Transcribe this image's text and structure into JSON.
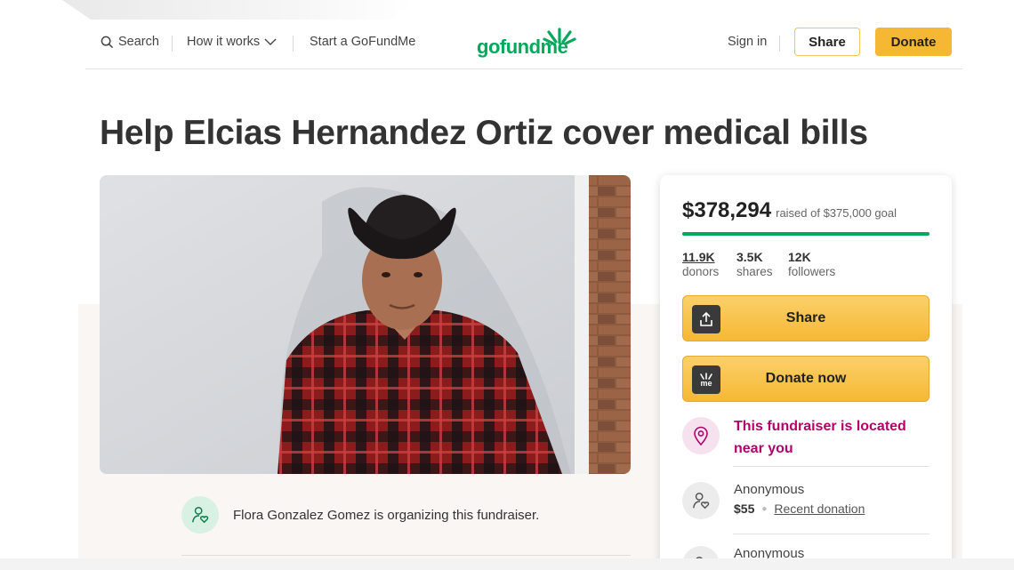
{
  "nav": {
    "search_label": "Search",
    "how_label": "How it works",
    "start_label": "Start a GoFundMe",
    "logo_text": "gofundme",
    "signin_label": "Sign in",
    "share_label": "Share",
    "donate_label": "Donate"
  },
  "campaign": {
    "title": "Help Elcias Hernandez Ortiz cover medical bills",
    "organizer_text": "Flora Gonzalez Gomez is organizing this fundraiser."
  },
  "card": {
    "raised_amount": "$378,294",
    "raised_goal": "raised of $375,000 goal",
    "progress_fraction": 1.0,
    "donors_num": "11.9K",
    "donors_label": "donors",
    "shares_num": "3.5K",
    "shares_label": "shares",
    "followers_num": "12K",
    "followers_label": "followers",
    "share_button": "Share",
    "donate_button": "Donate now",
    "donate_icon_text": "me",
    "location_text": "This fundraiser is located near you",
    "donations": [
      {
        "name": "Anonymous",
        "amount": "$55",
        "link": "Recent donation"
      },
      {
        "name": "Anonymous"
      }
    ]
  },
  "colors": {
    "brand_green": "#02a95c",
    "donate_yellow": "#f6b834",
    "location_magenta": "#b3006b"
  }
}
